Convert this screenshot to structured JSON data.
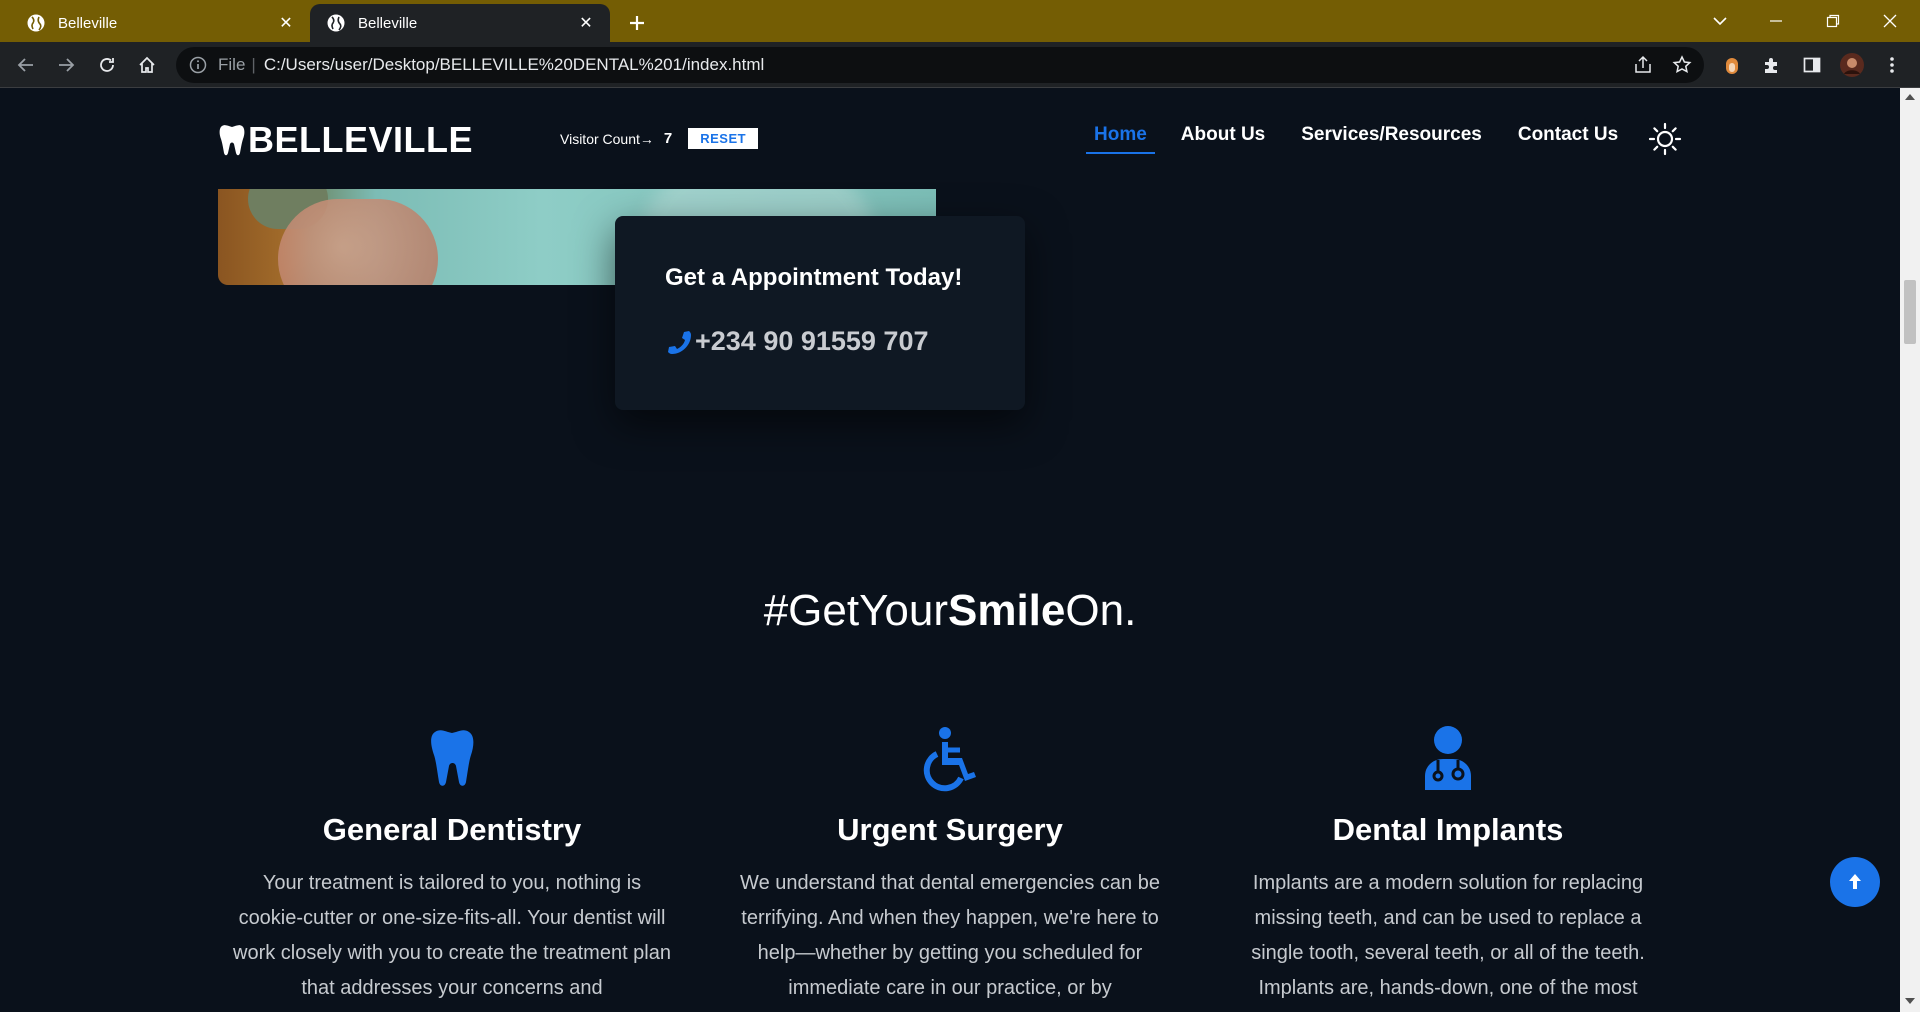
{
  "browser": {
    "tabs": [
      {
        "title": "Belleville",
        "active": false
      },
      {
        "title": "Belleville",
        "active": true
      }
    ],
    "address": {
      "scheme": "File",
      "separator": "|",
      "url": "C:/Users/user/Desktop/BELLEVILLE%20DENTAL%201/index.html"
    },
    "tab_close_glyph": "✕",
    "new_tab_glyph": "+"
  },
  "header": {
    "brand": "BELLEVILLE",
    "visitor_label": "Visitor Count→",
    "visitor_count": "7",
    "reset_label": "RESET",
    "nav": [
      {
        "label": "Home",
        "active": true
      },
      {
        "label": "About Us",
        "active": false
      },
      {
        "label": "Services/Resources",
        "active": false
      },
      {
        "label": "Contact Us",
        "active": false
      }
    ]
  },
  "appointment": {
    "title": "Get a Appointment Today!",
    "phone": "+234 90 91559 707"
  },
  "tagline": {
    "prefix": "#GetYour",
    "bold": "Smile",
    "suffix": "On."
  },
  "services": [
    {
      "icon": "tooth-icon",
      "title": "General Dentistry",
      "text": "Your treatment is tailored to you, nothing is cookie-cutter or one-size-fits-all. Your dentist will work closely with you to create the treatment plan that addresses your concerns and"
    },
    {
      "icon": "wheelchair-icon",
      "title": "Urgent Surgery",
      "text": "We understand that dental emergencies can be terrifying. And when they happen, we're here to help—whether by getting you scheduled for immediate care in our practice, or by"
    },
    {
      "icon": "doctor-icon",
      "title": "Dental Implants",
      "text": "Implants are a modern solution for replacing missing teeth, and can be used to replace a single tooth, several teeth, or all of the teeth. Implants are, hands-down, one of the most"
    }
  ],
  "colors": {
    "accent": "#1a73e8",
    "page_background": "#0a111b",
    "tab_strip": "#745d04"
  }
}
